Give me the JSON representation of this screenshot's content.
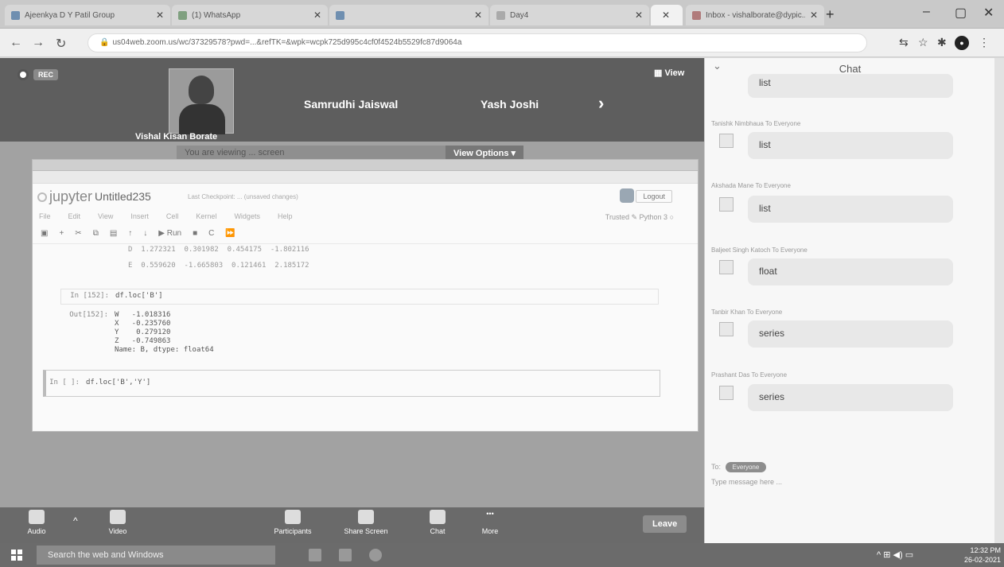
{
  "browser": {
    "tabs": [
      {
        "title": "Ajeenkya D Y Patil Group",
        "active": false
      },
      {
        "title": "(1) WhatsApp",
        "active": false
      },
      {
        "title": "",
        "active": false
      },
      {
        "title": "Day4",
        "active": false
      },
      {
        "title": "",
        "active": true
      },
      {
        "title": "Inbox - vishalborate@dypic...",
        "active": false
      }
    ],
    "url": "us04web.zoom.us/wc/37329578?pwd=...&refTK=&wpk=wcpk725d995c4cf0f4524b5529fc87d9064a"
  },
  "meeting": {
    "rec_label": "REC",
    "view_label": "View",
    "speaker_name": "Vishal Kisan Borate",
    "participants": [
      "Samrudhi Jaiswal",
      "Yash Joshi"
    ],
    "share_banner": "You are viewing ... screen",
    "view_options": "View Options"
  },
  "jupyter": {
    "logo": "jupyter",
    "notebook_title": "Untitled235",
    "checkpoint": "Last Checkpoint: ... (unsaved changes)",
    "logout": "Logout",
    "kernel": "Python 3",
    "kernel_status": "Trusted",
    "menu": [
      "File",
      "Edit",
      "View",
      "Insert",
      "Cell",
      "Kernel",
      "Widgets",
      "Help"
    ],
    "toolbar": [
      "+",
      "✂",
      "⧉",
      "▤",
      "↑",
      "↓",
      "▶ Run",
      "■",
      "C",
      "⏩"
    ],
    "df_rows": [
      {
        "label": "D",
        "values": "1.272321  0.301982  0.454175  -1.802116"
      },
      {
        "label": "E",
        "values": "0.559620  -1.665803  0.121461  2.185172"
      }
    ],
    "cell1_prompt": "In [152]:",
    "cell1_code": "df.loc['B']",
    "out_prompt": "Out[152]:",
    "out_lines": [
      "W   -1.018316",
      "X   -0.235760",
      "Y    0.279120",
      "Z   -0.749863",
      "Name: B, dtype: float64"
    ],
    "cell2_prompt": "In [ ]:",
    "cell2_code": "df.loc['B','Y']"
  },
  "zoom_toolbar": {
    "audio": "Audio",
    "video": "Video",
    "participants": "Participants",
    "share": "Share Screen",
    "chat": "Chat",
    "more": "More",
    "leave": "Leave"
  },
  "chat": {
    "title": "Chat",
    "first_message": "list",
    "messages": [
      {
        "sender": "Tanishk Nimbhaua To Everyone",
        "text": "list"
      },
      {
        "sender": "Akshada Mane To Everyone",
        "text": "list"
      },
      {
        "sender": "Baljeet Singh Katoch To Everyone",
        "text": "float"
      },
      {
        "sender": "Tanbir Khan To Everyone",
        "text": "series"
      },
      {
        "sender": "Prashant Das To Everyone",
        "text": "series"
      }
    ],
    "to_label": "To:",
    "to_value": "Everyone",
    "placeholder": "Type message here ..."
  },
  "taskbar": {
    "search": "Search the web and Windows",
    "time": "12:32 PM",
    "date": "26-02-2021"
  }
}
